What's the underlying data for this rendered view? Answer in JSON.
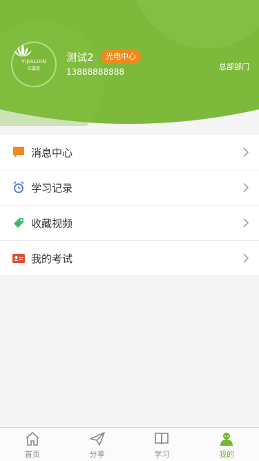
{
  "profile": {
    "avatar_logo_text": "YIJIALIAN",
    "avatar_logo_sub": "亿嘉琏",
    "name": "测试2",
    "badge": "光电中心",
    "phone": "13888888888",
    "department": "总部部门"
  },
  "menu": {
    "items": [
      {
        "label": "消息中心",
        "icon": "chat-bubble-icon",
        "color": "#f08a1c"
      },
      {
        "label": "学习记录",
        "icon": "alarm-clock-icon",
        "color": "#5b7fd9"
      },
      {
        "label": "收藏视频",
        "icon": "tag-icon",
        "color": "#3cb86a"
      },
      {
        "label": "我的考试",
        "icon": "id-card-icon",
        "color": "#e04e2e"
      }
    ]
  },
  "tabbar": {
    "items": [
      {
        "label": "首页",
        "icon": "home-icon",
        "active": false
      },
      {
        "label": "分享",
        "icon": "paper-plane-icon",
        "active": false
      },
      {
        "label": "学习",
        "icon": "book-icon",
        "active": false
      },
      {
        "label": "我的",
        "icon": "person-icon",
        "active": true
      }
    ]
  },
  "colors": {
    "header_green": "#7dba3b",
    "accent_green": "#76b833",
    "badge_orange": "#f08a1c"
  }
}
